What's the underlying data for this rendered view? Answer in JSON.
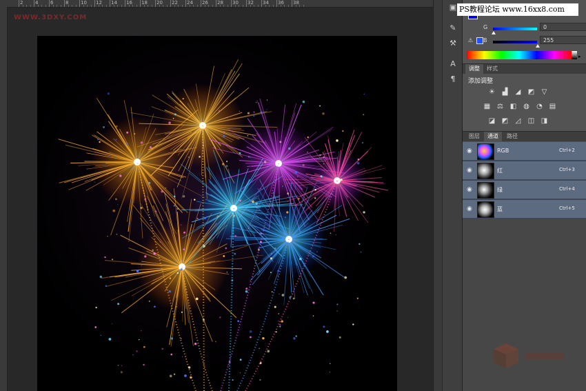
{
  "watermark": "WWW.3DXY.COM",
  "ruler": {
    "labels": [
      "2",
      "4",
      "6",
      "8",
      "10",
      "12",
      "14",
      "16",
      "18",
      "20",
      "22",
      "24",
      "26",
      "28",
      "30",
      "32",
      "34",
      "36",
      "38"
    ]
  },
  "overlay": {
    "forum_text": "PS教程论坛 www.16xx8.com"
  },
  "color_panel": {
    "r": {
      "label": "",
      "value": ""
    },
    "g": {
      "label": "G",
      "value": "0"
    },
    "b": {
      "label": "B",
      "value": "255"
    },
    "fg_color": "#0000ff"
  },
  "adjust_tabs": [
    {
      "label": "调整",
      "active": true
    },
    {
      "label": "样式",
      "active": false
    }
  ],
  "adjust_title": "添加调整",
  "adjust_icons_row1": [
    "brightness-icon",
    "levels-icon",
    "curves-icon",
    "exposure-icon",
    "triangle-icon"
  ],
  "adjust_icons_row2": [
    "vibrance-icon",
    "balance-icon",
    "bw-icon",
    "photo-filter-icon",
    "mixer-icon",
    "lookup-icon"
  ],
  "adjust_icons_row3": [
    "invert-icon",
    "posterize-icon",
    "threshold-icon",
    "gradient-map-icon",
    "selective-color-icon"
  ],
  "layer_tabs": [
    {
      "label": "图层",
      "active": false
    },
    {
      "label": "通道",
      "active": true
    },
    {
      "label": "路径",
      "active": false
    }
  ],
  "channels": [
    {
      "name": "RGB",
      "shortcut": "Ctrl+2"
    },
    {
      "name": "红",
      "shortcut": "Ctrl+3"
    },
    {
      "name": "绿",
      "shortcut": "Ctrl+4"
    },
    {
      "name": "蓝",
      "shortcut": "Ctrl+5"
    }
  ]
}
